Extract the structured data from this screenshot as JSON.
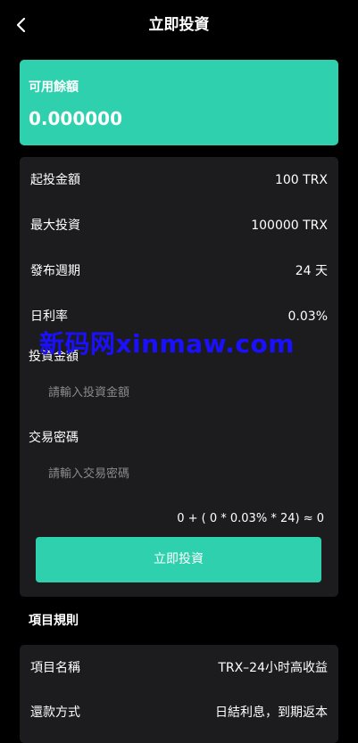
{
  "header": {
    "title": "立即投資",
    "back_icon": "chevron-left-icon"
  },
  "balance": {
    "label": "可用餘額",
    "value": "0.000000"
  },
  "info_rows": [
    {
      "label": "起投金額",
      "value": "100 TRX"
    },
    {
      "label": "最大投資",
      "value": "100000 TRX"
    },
    {
      "label": "發布週期",
      "value": "24 天"
    },
    {
      "label": "日利率",
      "value": "0.03%"
    }
  ],
  "form": {
    "amount_label": "投資金額",
    "amount_placeholder": "請輸入投資金額",
    "password_label": "交易密碼",
    "password_placeholder": "請輸入交易密碼",
    "formula": "0 + ( 0 * 0.03% * 24) ≈ 0",
    "submit_label": "立即投資"
  },
  "rules": {
    "title": "項目規則",
    "rows": [
      {
        "label": "項目名稱",
        "value": "TRX–24小时高收益"
      },
      {
        "label": "還款方式",
        "value": "日結利息，到期返本"
      }
    ]
  },
  "watermark": "新码网xinmaw.com",
  "colors": {
    "accent": "#2fd0ae",
    "background": "#000000",
    "panel": "#1c1c1e",
    "watermark": "#1a10ff"
  }
}
